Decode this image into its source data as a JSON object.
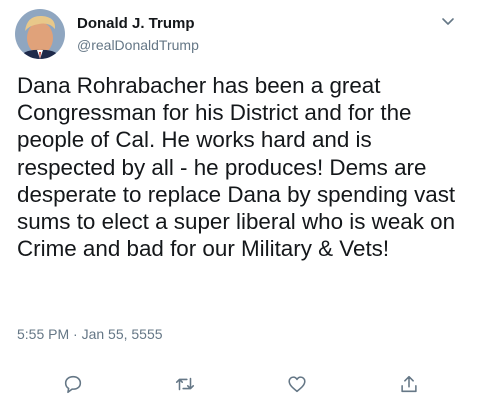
{
  "tweet": {
    "author_name": "Donald J. Trump",
    "author_handle": "@realDonaldTrump",
    "text": "Dana Rohrabacher has been a great Congressman for his District and for the people of Cal. He works hard and is respected by all - he produces! Dems are desperate to replace Dana by spending vast sums to elect a super liberal who is weak on Crime and bad for our Military & Vets!",
    "timestamp": "5:55 PM · Jan 55, 5555"
  },
  "icons": {
    "menu": "chevron-down-icon",
    "reply": "reply-icon",
    "retweet": "retweet-icon",
    "like": "heart-icon",
    "share": "share-icon"
  },
  "colors": {
    "text": "#14171a",
    "secondary": "#657786",
    "icon": "#657786"
  }
}
